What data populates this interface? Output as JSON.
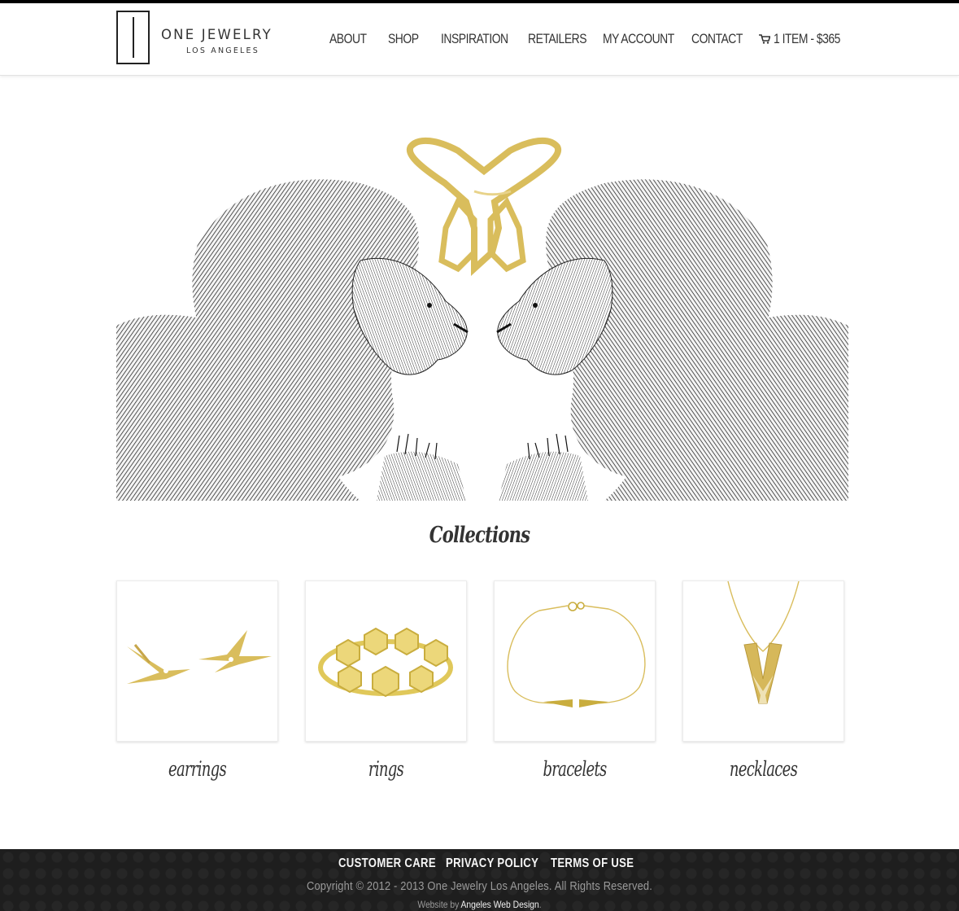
{
  "brand": {
    "name": "ONE JEWELRY",
    "location": "LOS ANGELES"
  },
  "nav": {
    "items": [
      {
        "label": "ABOUT"
      },
      {
        "label": "SHOP"
      },
      {
        "label": "INSPIRATION"
      },
      {
        "label": "RETAILERS"
      },
      {
        "label": "MY ACCOUNT"
      },
      {
        "label": "CONTACT"
      }
    ],
    "cart": {
      "label": "1 ITEM - $365",
      "icon": "shopping-cart-icon"
    }
  },
  "hero": {
    "image": "two mirrored engraved lions facing a gold diamond ring"
  },
  "collections": {
    "title": "Collections",
    "items": [
      {
        "label": "earrings"
      },
      {
        "label": "rings"
      },
      {
        "label": "bracelets"
      },
      {
        "label": "necklaces"
      }
    ]
  },
  "footer": {
    "links": [
      {
        "label": "CUSTOMER CARE"
      },
      {
        "label": "PRIVACY POLICY"
      },
      {
        "label": "TERMS OF USE"
      }
    ],
    "copyright": "Copyright © 2012 - 2013 One Jewelry Los Angeles. All Rights Reserved.",
    "credit_prefix": "Website by ",
    "credit_link": "Angeles Web Design",
    "credit_suffix": "."
  },
  "colors": {
    "gold": "#d9bd5c",
    "text": "#333333",
    "footer_bg": "#1e1e1e"
  }
}
